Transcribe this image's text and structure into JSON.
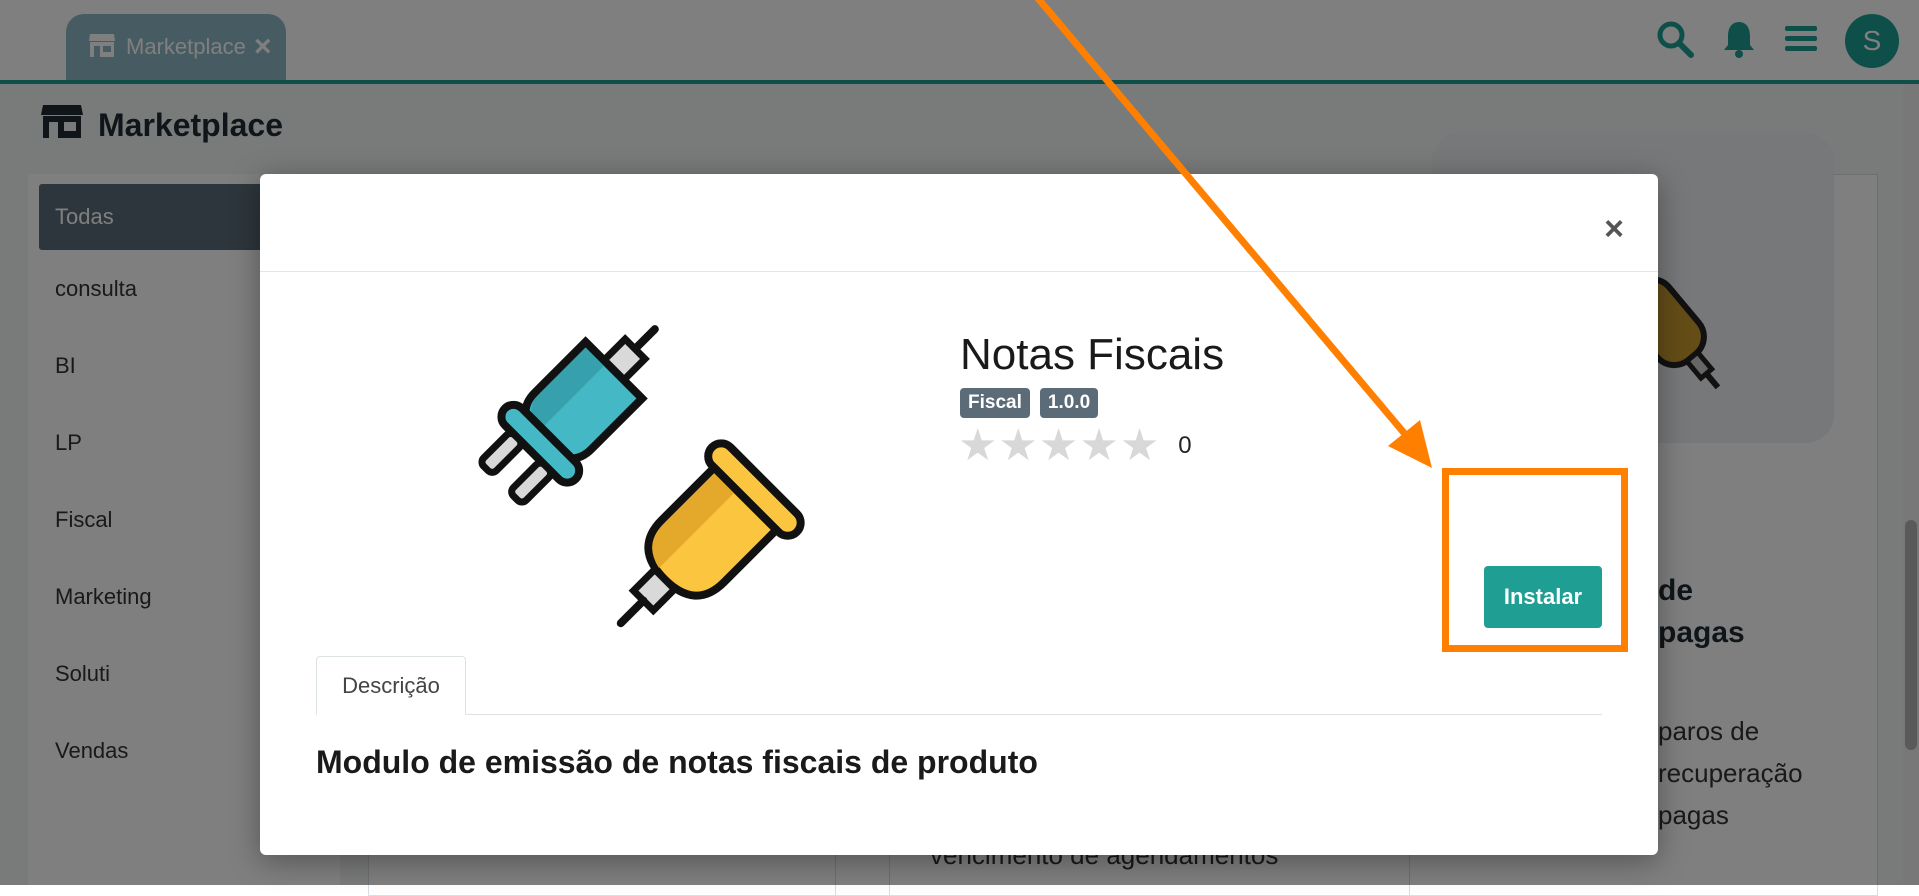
{
  "header": {
    "tab_label": "Marketplace",
    "tab_close": "×",
    "user_initial": "S",
    "icons": [
      "store-icon",
      "search-icon",
      "bell-icon",
      "menu-icon"
    ]
  },
  "page": {
    "title": "Marketplace"
  },
  "sidebar": {
    "items": [
      {
        "label": "Todas"
      },
      {
        "label": "consulta"
      },
      {
        "label": "BI"
      },
      {
        "label": "LP"
      },
      {
        "label": "Fiscal"
      },
      {
        "label": "Marketing"
      },
      {
        "label": "Soluti"
      },
      {
        "label": "Vendas"
      }
    ]
  },
  "background_cards": {
    "right_title": "de\npagas",
    "right_text": "paros de\nrecuperação\npagas",
    "middle_text": "vencimento de agendamentos"
  },
  "modal": {
    "close": "×",
    "app_name": "Notas Fiscais",
    "badges": [
      "Fiscal",
      "1.0.0"
    ],
    "stars_total": 5,
    "stars_filled": 0,
    "rating_count": "0",
    "install_label": "Instalar",
    "tab_label": "Descrição",
    "description_heading": "Modulo de emissão de notas fiscais de produto"
  },
  "colors": {
    "accent": "#1f9e94",
    "badge": "#5b6c78",
    "annotation": "#ff8000"
  }
}
